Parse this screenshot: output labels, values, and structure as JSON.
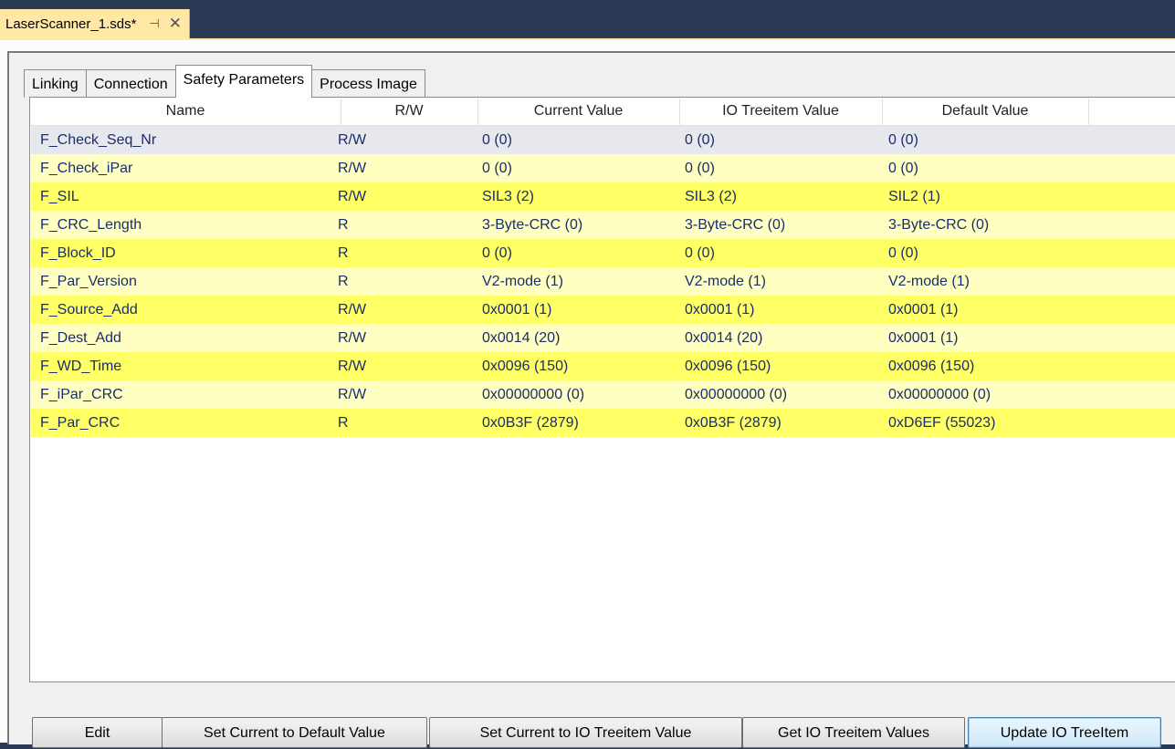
{
  "document_tab": {
    "title": "LaserScanner_1.sds*",
    "pin_icon": "pin-icon",
    "close_icon": "close-icon"
  },
  "tabs": [
    {
      "label": "Linking",
      "active": false
    },
    {
      "label": "Connection",
      "active": false
    },
    {
      "label": "Safety Parameters",
      "active": true
    },
    {
      "label": "Process Image",
      "active": false
    }
  ],
  "table": {
    "columns": [
      "Name",
      "R/W",
      "Current Value",
      "IO Treeitem Value",
      "Default Value"
    ],
    "rows": [
      {
        "name": "F_Check_Seq_Nr",
        "rw": "R/W",
        "current": "0 (0)",
        "io": "0 (0)",
        "default": "0 (0)"
      },
      {
        "name": "F_Check_iPar",
        "rw": "R/W",
        "current": "0 (0)",
        "io": "0 (0)",
        "default": "0 (0)"
      },
      {
        "name": "F_SIL",
        "rw": "R/W",
        "current": "SIL3 (2)",
        "io": "SIL3 (2)",
        "default": "SIL2 (1)"
      },
      {
        "name": "F_CRC_Length",
        "rw": "R",
        "current": "3-Byte-CRC (0)",
        "io": "3-Byte-CRC (0)",
        "default": "3-Byte-CRC (0)"
      },
      {
        "name": "F_Block_ID",
        "rw": "R",
        "current": "0 (0)",
        "io": "0 (0)",
        "default": "0 (0)"
      },
      {
        "name": "F_Par_Version",
        "rw": "R",
        "current": "V2-mode (1)",
        "io": "V2-mode (1)",
        "default": "V2-mode (1)"
      },
      {
        "name": "F_Source_Add",
        "rw": "R/W",
        "current": "0x0001 (1)",
        "io": "0x0001 (1)",
        "default": "0x0001 (1)"
      },
      {
        "name": "F_Dest_Add",
        "rw": "R/W",
        "current": "0x0014 (20)",
        "io": "0x0014 (20)",
        "default": "0x0001 (1)"
      },
      {
        "name": "F_WD_Time",
        "rw": "R/W",
        "current": "0x0096 (150)",
        "io": "0x0096 (150)",
        "default": "0x0096 (150)"
      },
      {
        "name": "F_iPar_CRC",
        "rw": "R/W",
        "current": "0x00000000 (0)",
        "io": "0x00000000 (0)",
        "default": "0x00000000 (0)"
      },
      {
        "name": "F_Par_CRC",
        "rw": "R",
        "current": "0x0B3F (2879)",
        "io": "0x0B3F (2879)",
        "default": "0xD6EF (55023)"
      }
    ]
  },
  "buttons": {
    "edit": "Edit",
    "set_default": "Set Current to Default Value",
    "set_io": "Set Current to IO Treeitem Value",
    "get_io": "Get IO Treeitem Values",
    "update_io": "Update IO TreeItem"
  },
  "colors": {
    "highlight_yellow": "#ffff66",
    "light_yellow": "#ffffc2",
    "selected_row": "#e6e8ee",
    "title_bar": "#2b3a55",
    "doc_tab": "#ffe8a6"
  }
}
